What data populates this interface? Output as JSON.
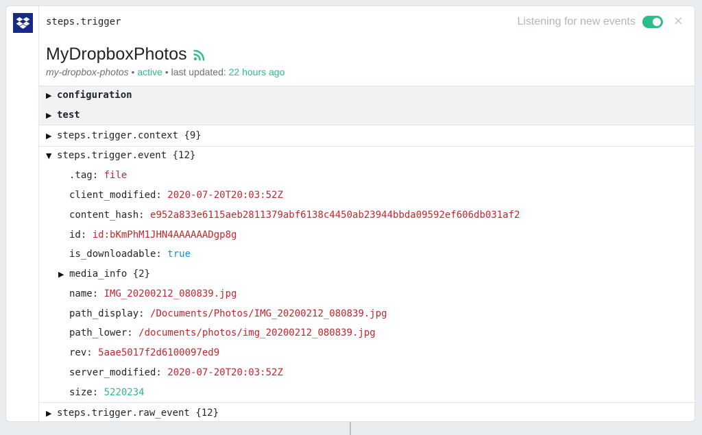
{
  "header": {
    "step_name": "steps.trigger",
    "listening_label": "Listening for new events",
    "listening_enabled": true,
    "close_glyph": "×",
    "app_icon": "dropbox-logo-icon"
  },
  "source": {
    "title": "MyDropboxPhotos",
    "status_icon": "rss-feed-icon",
    "slug": "my-dropbox-photos",
    "bullet": "•",
    "status": "active",
    "last_updated_label": "last updated:",
    "last_updated_value": "22 hours ago"
  },
  "sections": {
    "configuration": "configuration",
    "test": "test"
  },
  "context": {
    "label": "steps.trigger.context",
    "count": "{9}"
  },
  "event": {
    "label": "steps.trigger.event",
    "count": "{12}",
    "fields": {
      "tag": {
        "key": ".tag:",
        "value": "file"
      },
      "client_modified": {
        "key": "client_modified:",
        "value": "2020-07-20T20:03:52Z"
      },
      "content_hash": {
        "key": "content_hash:",
        "value": "e952a833e6115aeb2811379abf6138c4450ab23944bbda09592ef606db031af2"
      },
      "id": {
        "key": "id:",
        "value": "id:bKmPhM1JHN4AAAAAADgp8g"
      },
      "is_downloadable": {
        "key": "is_downloadable:",
        "value": "true"
      },
      "media_info": {
        "key": "media_info",
        "count": "{2}"
      },
      "name": {
        "key": "name:",
        "value": "IMG_20200212_080839.jpg"
      },
      "path_display": {
        "key": "path_display:",
        "value": "/Documents/Photos/IMG_20200212_080839.jpg"
      },
      "path_lower": {
        "key": "path_lower:",
        "value": "/documents/photos/img_20200212_080839.jpg"
      },
      "rev": {
        "key": "rev:",
        "value": "5aae5017f2d6100097ed9"
      },
      "server_modified": {
        "key": "server_modified:",
        "value": "2020-07-20T20:03:52Z"
      },
      "size": {
        "key": "size:",
        "value": "5220234"
      }
    }
  },
  "raw_event": {
    "label": "steps.trigger.raw_event",
    "count": "{12}"
  },
  "colors": {
    "string": "#c7252c",
    "boolean": "#1b8ee0",
    "number": "#2bbd86",
    "accent_green": "#2bbd86",
    "dropbox_blue": "#172a87"
  }
}
